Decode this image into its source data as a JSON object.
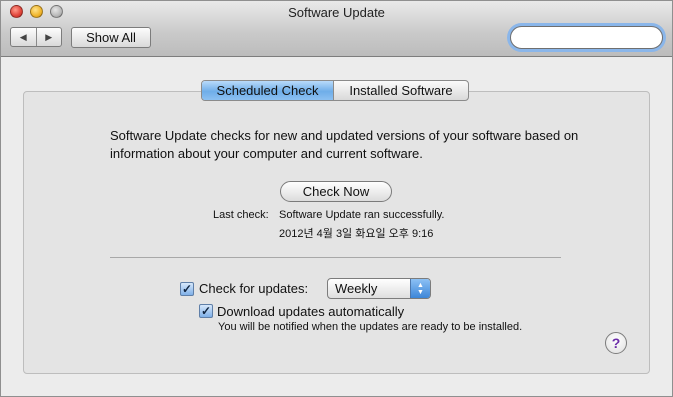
{
  "window": {
    "title": "Software Update"
  },
  "toolbar": {
    "back_icon": "triangle-left-icon",
    "forward_icon": "triangle-right-icon",
    "show_all_label": "Show All",
    "search_value": "",
    "search_placeholder": ""
  },
  "tabs": [
    {
      "label": "Scheduled Check",
      "active": true
    },
    {
      "label": "Installed Software",
      "active": false
    }
  ],
  "main": {
    "description": "Software Update checks for new and updated versions of your software based on information about your computer and current software.",
    "check_now_label": "Check Now",
    "last_check_label": "Last check:",
    "last_check_status": "Software Update ran successfully.",
    "last_check_datetime": "2012년 4월 3일 화요일 오후 9:16",
    "check_updates_label": "Check for updates:",
    "check_updates_checked": true,
    "frequency_value": "Weekly",
    "download_label": "Download updates automatically",
    "download_checked": true,
    "download_note": "You will be notified when the updates are ready to be installed.",
    "help_label": "?"
  },
  "colors": {
    "accent": "#6faee9",
    "help_glyph": "#6b2da8"
  }
}
